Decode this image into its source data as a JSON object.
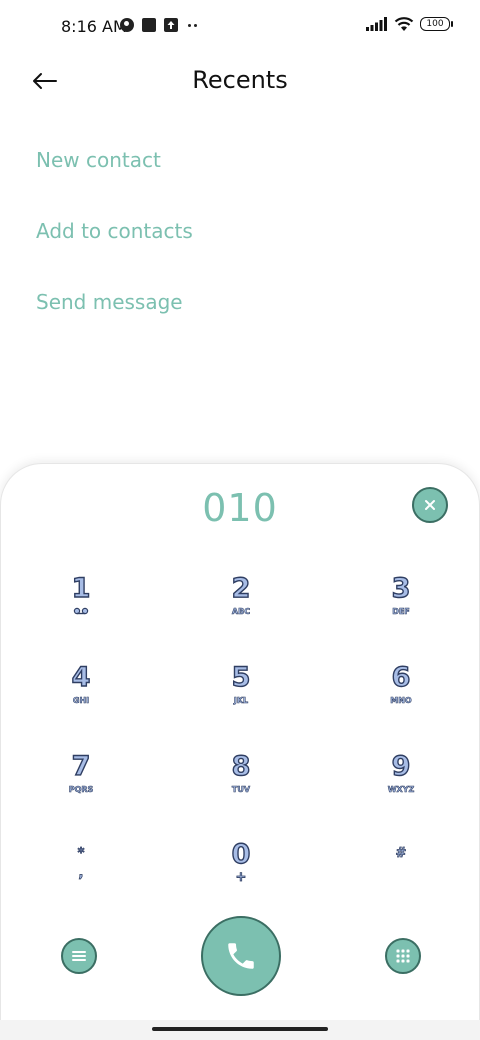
{
  "status_bar": {
    "time": "8:16 AM",
    "battery": "100",
    "icons_left": [
      "vpn-icon",
      "square-icon",
      "upload-icon",
      "more-dots-icon"
    ],
    "icons_right": [
      "signal-icon",
      "wifi-icon",
      "battery-icon"
    ]
  },
  "header": {
    "title": "Recents",
    "back_icon": "back-arrow-icon"
  },
  "actions": [
    {
      "label": "New contact"
    },
    {
      "label": "Add to contacts"
    },
    {
      "label": "Send message"
    }
  ],
  "dialer": {
    "number": "010",
    "clear_icon": "close-icon",
    "keys": [
      {
        "digit": "1",
        "letters": "QO"
      },
      {
        "digit": "2",
        "letters": "ABC"
      },
      {
        "digit": "3",
        "letters": "DEF"
      },
      {
        "digit": "4",
        "letters": "GHI"
      },
      {
        "digit": "5",
        "letters": "JKL"
      },
      {
        "digit": "6",
        "letters": "MNO"
      },
      {
        "digit": "7",
        "letters": "PQRS"
      },
      {
        "digit": "8",
        "letters": "TUV"
      },
      {
        "digit": "9",
        "letters": "WXYZ"
      },
      {
        "digit": "*",
        "letters": ","
      },
      {
        "digit": "0",
        "letters": "+"
      },
      {
        "digit": "#",
        "letters": ""
      }
    ],
    "menu_icon": "menu-icon",
    "call_icon": "phone-icon",
    "keypad_icon": "dialpad-icon"
  },
  "colors": {
    "accent": "#7cc0b0",
    "key_fill": "#a8bde6",
    "key_outline": "#2f3e62"
  }
}
